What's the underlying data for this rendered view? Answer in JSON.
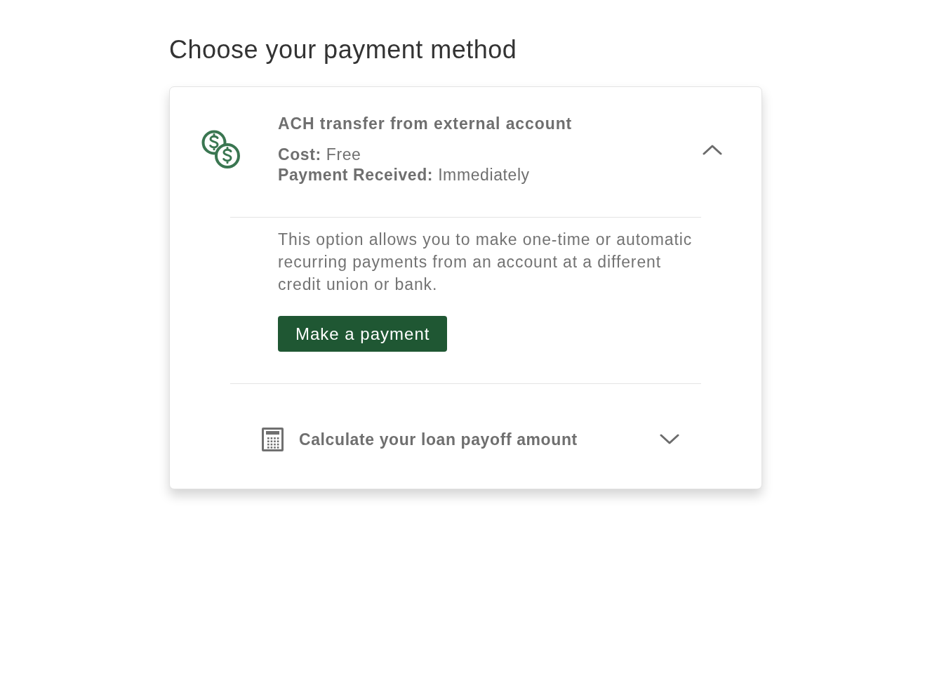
{
  "heading": "Choose your payment method",
  "options": [
    {
      "kind": "payment_method",
      "title": "ACH transfer from external account",
      "details": [
        "**Cost:** Free",
        "**Payment Received:** Immediately"
      ],
      "expanded": true,
      "description": "This option allows you to make one-time or automatic recurring payments from an account at a different credit union or bank.",
      "button": "Make a payment"
    },
    {
      "kind": "tool",
      "title": "Calculate your loan payoff amount",
      "expanded": false
    }
  ]
}
